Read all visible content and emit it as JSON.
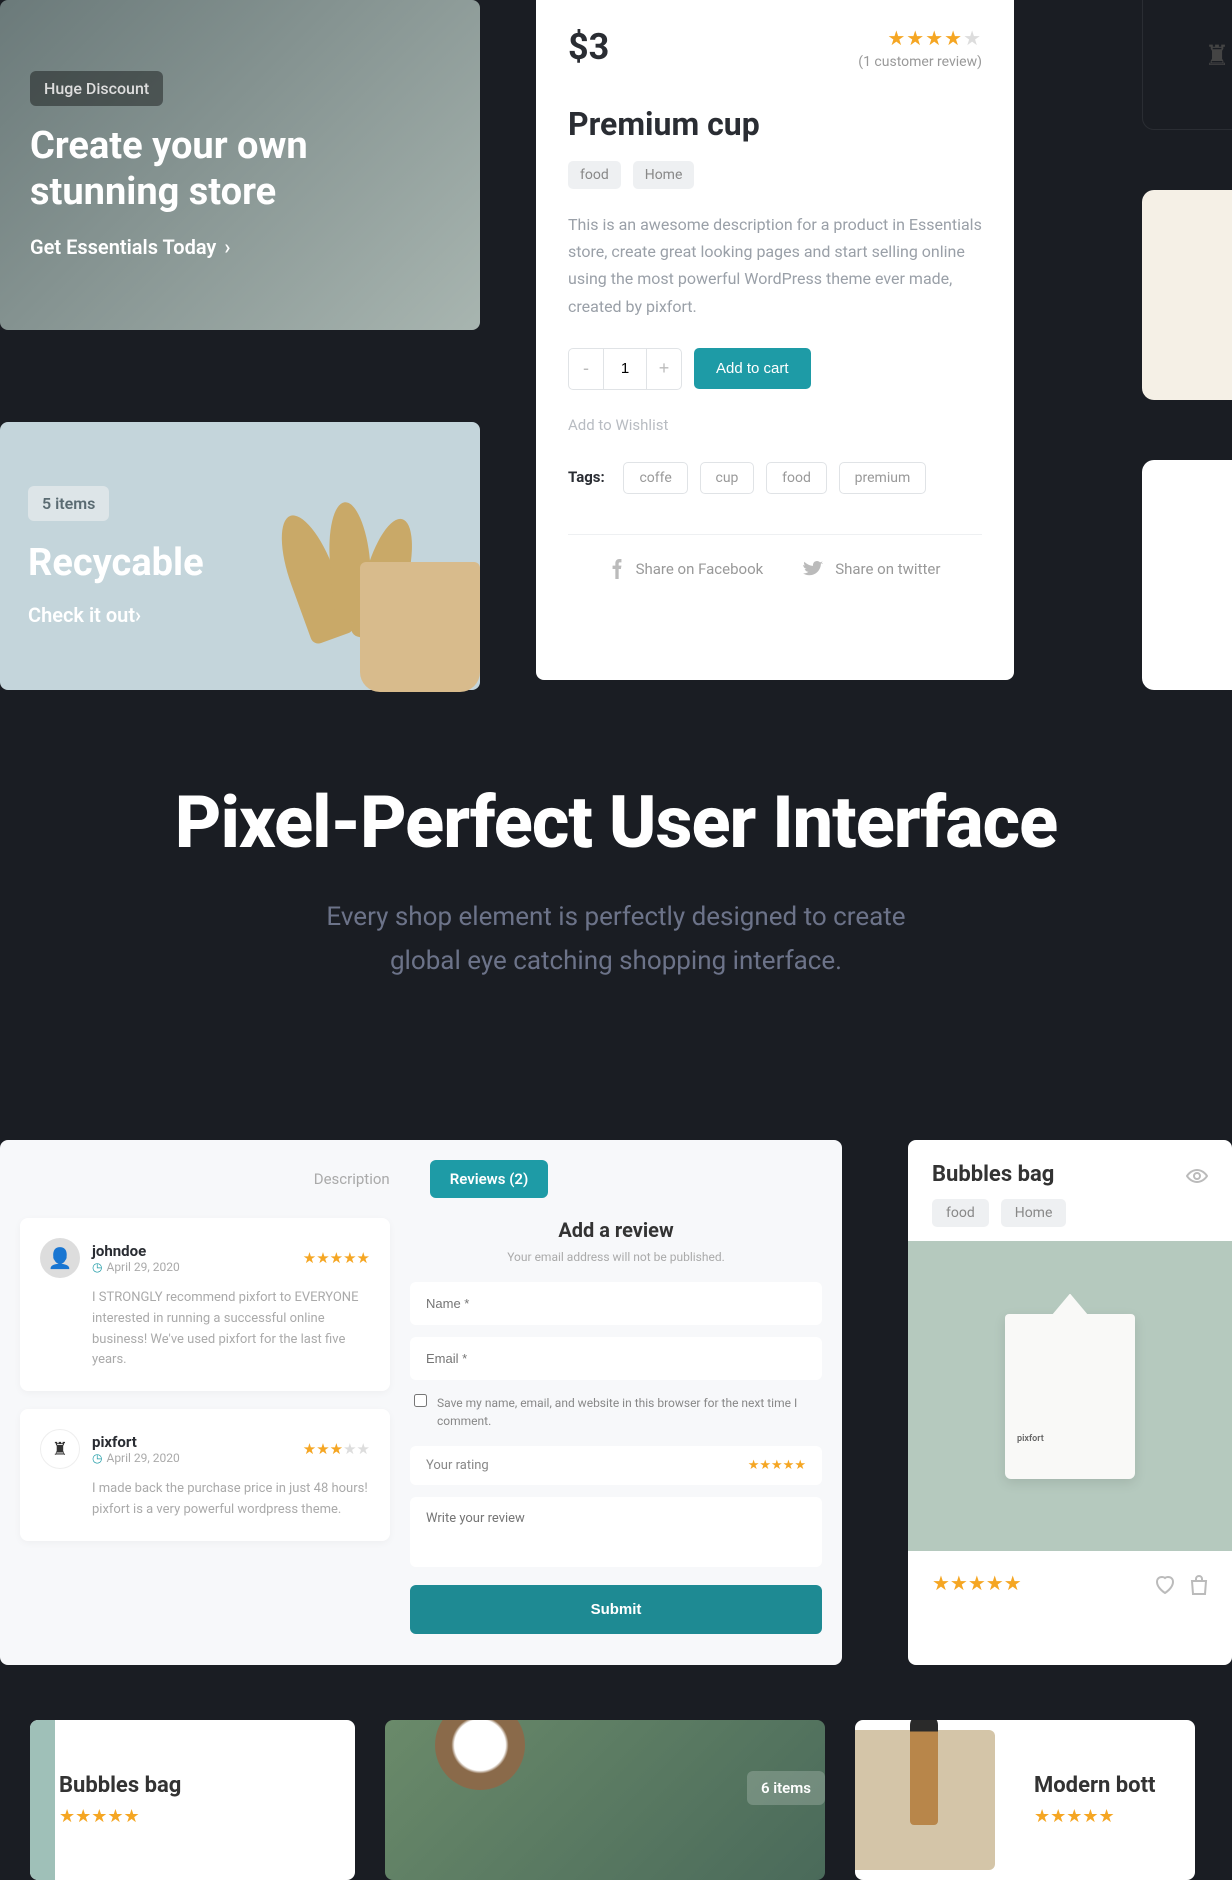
{
  "promo1": {
    "badge": "Huge Discount",
    "title": "Create your own stunning store",
    "link": "Get Essentials Today"
  },
  "promo2": {
    "badge": "5 items",
    "title": "Recycable",
    "link": "Check it out"
  },
  "product": {
    "price": "$3",
    "stars": 4,
    "review_count": "(1 customer review)",
    "title": "Premium cup",
    "categories": [
      "food",
      "Home"
    ],
    "description": "This is an awesome description for a product in Essentials store, create great looking pages and start selling online using the most powerful WordPress theme ever made, created by pixfort.",
    "qty": "1",
    "add_to_cart": "Add to cart",
    "wishlist": "Add to Wishlist",
    "tags_label": "Tags:",
    "tags": [
      "coffe",
      "cup",
      "food",
      "premium"
    ],
    "share_fb": "Share on Facebook",
    "share_tw": "Share on twitter"
  },
  "hero": {
    "title": "Pixel-Perfect User Interface",
    "line1": "Every shop element is perfectly designed to create",
    "line2": "global eye catching shopping interface."
  },
  "reviews": {
    "tab1": "Description",
    "tab2": "Reviews (2)",
    "add_title": "Add a review",
    "note": "Your email address will not be published.",
    "name_ph": "Name *",
    "email_ph": "Email *",
    "save_label": "Save my name, email, and website in this browser for the next time I comment.",
    "rating_label": "Your rating",
    "review_ph": "Write your review",
    "submit": "Submit",
    "items": [
      {
        "name": "johndoe",
        "date": "April 29, 2020",
        "stars": 5,
        "body": "I STRONGLY recommend pixfort to EVERYONE interested in running a successful online business! We've used pixfort for the last five years."
      },
      {
        "name": "pixfort",
        "date": "April 29, 2020",
        "stars": 3,
        "body": "I made back the purchase price in just 48 hours! pixfort is a very powerful wordpress theme."
      }
    ]
  },
  "grid_card": {
    "title": "Bubbles bag",
    "tags": [
      "food",
      "Home"
    ],
    "brand": "pixfort"
  },
  "bottom": {
    "card1_title": "Bubbles bag",
    "card2_badge": "6 items",
    "card3_title": "Modern bott"
  }
}
